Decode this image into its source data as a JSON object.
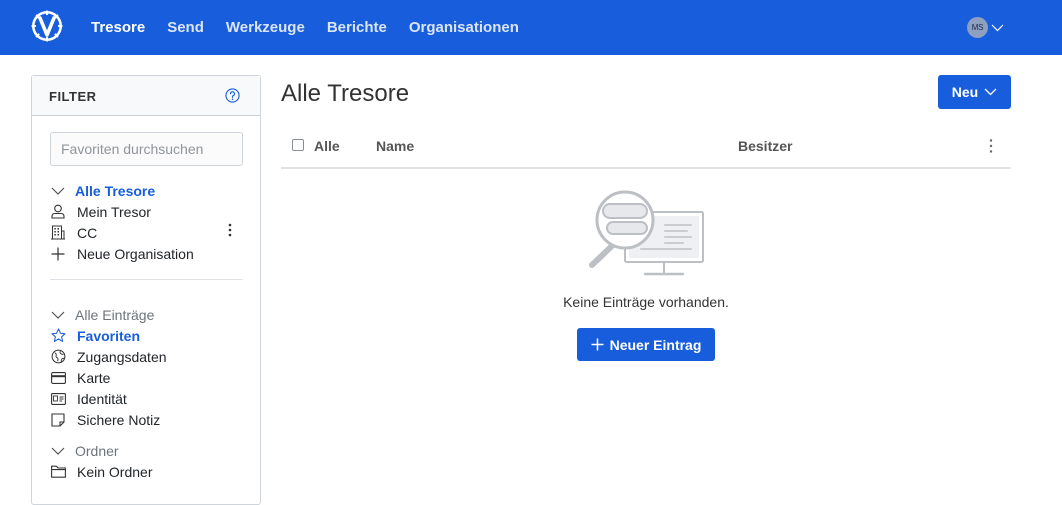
{
  "topnav": {
    "items": [
      {
        "label": "Tresore",
        "active": true
      },
      {
        "label": "Send",
        "active": false
      },
      {
        "label": "Werkzeuge",
        "active": false
      },
      {
        "label": "Berichte",
        "active": false
      },
      {
        "label": "Organisationen",
        "active": false
      }
    ],
    "avatar_initials": "MS"
  },
  "filter": {
    "title": "FILTER",
    "search_placeholder": "Favoriten durchsuchen",
    "vaults": {
      "header": "Alle Tresore",
      "items": [
        {
          "label": "Mein Tresor",
          "icon": "user-icon"
        },
        {
          "label": "CC",
          "icon": "building-icon"
        },
        {
          "label": "Neue Organisation",
          "icon": "plus-icon"
        }
      ]
    },
    "types": {
      "header": "Alle Einträge",
      "items": [
        {
          "label": "Favoriten",
          "icon": "star-icon",
          "selected": true
        },
        {
          "label": "Zugangsdaten",
          "icon": "globe-icon"
        },
        {
          "label": "Karte",
          "icon": "credit-card-icon"
        },
        {
          "label": "Identität",
          "icon": "id-card-icon"
        },
        {
          "label": "Sichere Notiz",
          "icon": "sticky-note-icon"
        }
      ]
    },
    "folders": {
      "header": "Ordner",
      "items": [
        {
          "label": "Kein Ordner",
          "icon": "folder-icon"
        }
      ]
    }
  },
  "main": {
    "title": "Alle Tresore",
    "new_button": "Neu",
    "columns": {
      "all": "Alle",
      "name": "Name",
      "owner": "Besitzer"
    },
    "empty_text": "Keine Einträge vorhanden.",
    "new_entry_button": "Neuer Eintrag"
  },
  "colors": {
    "primary": "#175ddc",
    "border": "#ced4da",
    "muted": "#6c757d"
  }
}
